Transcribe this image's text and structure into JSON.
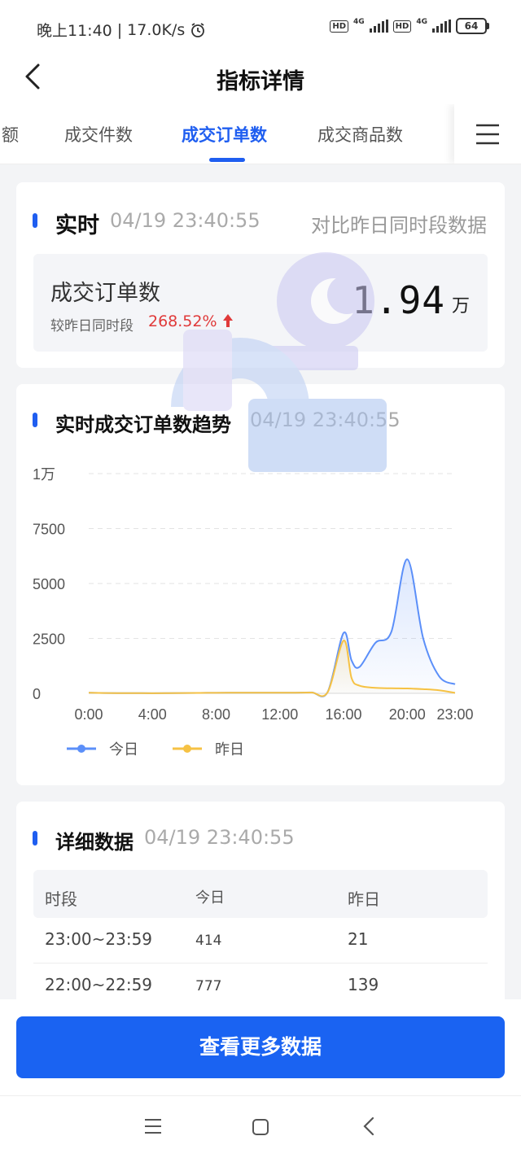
{
  "status": {
    "time": "晚上11:40",
    "speed": "17.0K/s",
    "hd1": "HD",
    "hd2": "HD",
    "net1": "4G",
    "net2": "4G",
    "battery": "64"
  },
  "nav": {
    "title": "指标详情",
    "back_icon": "chevron-left-icon"
  },
  "tabs": {
    "items": [
      {
        "label": "额"
      },
      {
        "label": "成交件数"
      },
      {
        "label": "成交订单数",
        "active": true
      },
      {
        "label": "成交商品数"
      }
    ],
    "menu_icon": "hamburger-menu-icon"
  },
  "realtime": {
    "title": "实时",
    "timestamp": "04/19 23:40:55",
    "compare_note": "对比昨日同时段数据",
    "metric_name": "成交订单数",
    "compare_label": "较昨日同时段",
    "compare_value": "268.52%",
    "trend_icon": "arrow-up-icon",
    "value": "1.94",
    "unit": "万"
  },
  "trend": {
    "title": "实时成交订单数趋势",
    "timestamp": "04/19 23:40:55"
  },
  "chart_data": {
    "type": "line",
    "x": [
      "0:00",
      "1:00",
      "2:00",
      "3:00",
      "4:00",
      "5:00",
      "6:00",
      "7:00",
      "8:00",
      "9:00",
      "10:00",
      "11:00",
      "12:00",
      "13:00",
      "14:00",
      "15:00",
      "16:00",
      "16:30",
      "17:00",
      "18:00",
      "19:00",
      "20:00",
      "21:00",
      "22:00",
      "23:00"
    ],
    "xticks": [
      "0:00",
      "4:00",
      "8:00",
      "12:00",
      "16:00",
      "20:00",
      "23:00"
    ],
    "yticks": [
      "0",
      "2500",
      "5000",
      "7500",
      "1万"
    ],
    "ylim": [
      0,
      10000
    ],
    "series": [
      {
        "name": "今日",
        "color": "#5b8ff9",
        "values": [
          30,
          15,
          10,
          8,
          6,
          8,
          12,
          18,
          25,
          28,
          30,
          30,
          30,
          30,
          40,
          60,
          2750,
          1500,
          1200,
          2300,
          2800,
          6100,
          2500,
          777,
          414
        ]
      },
      {
        "name": "昨日",
        "color": "#f6c244",
        "values": [
          30,
          15,
          10,
          8,
          6,
          8,
          12,
          18,
          25,
          28,
          30,
          30,
          30,
          30,
          35,
          50,
          2400,
          700,
          350,
          250,
          230,
          220,
          190,
          139,
          21
        ]
      }
    ],
    "legend": "bottom-left",
    "grid": true
  },
  "detail": {
    "title": "详细数据",
    "timestamp": "04/19 23:40:55",
    "columns": [
      "时段",
      "今日",
      "昨日"
    ],
    "rows": [
      [
        "23:00~23:59",
        "414",
        "21"
      ],
      [
        "22:00~22:59",
        "777",
        "139"
      ]
    ]
  },
  "cta": {
    "label": "查看更多数据"
  },
  "sysnav": {
    "icons": [
      "menu-icon",
      "home-square-icon",
      "back-icon"
    ]
  }
}
